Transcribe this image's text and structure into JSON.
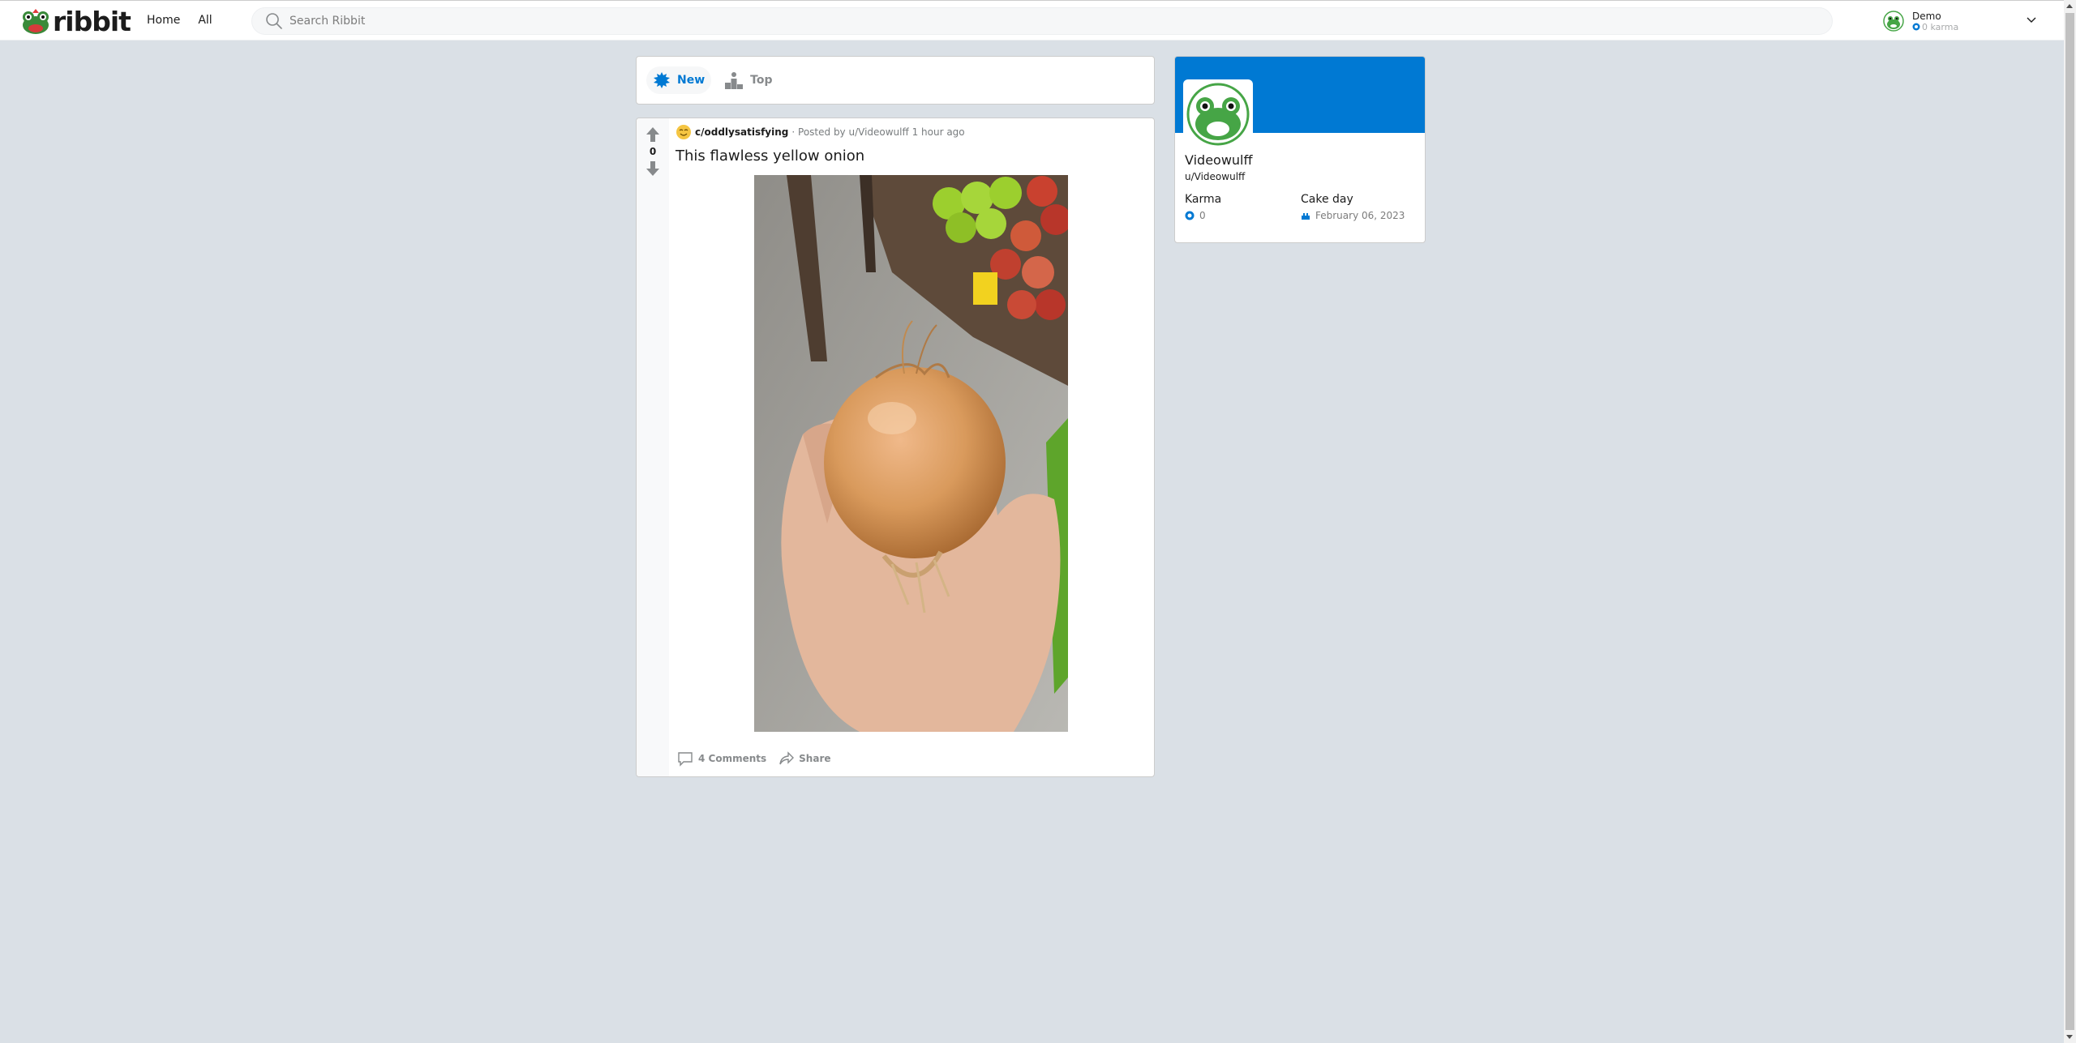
{
  "header": {
    "logo_text": "ribbit",
    "nav": [
      {
        "label": "Home"
      },
      {
        "label": "All"
      }
    ],
    "search": {
      "placeholder": "Search Ribbit",
      "value": ""
    },
    "user": {
      "name": "Demo",
      "karma": "0 karma"
    }
  },
  "sort": {
    "options": [
      {
        "label": "New",
        "active": true,
        "icon": "starburst-icon"
      },
      {
        "label": "Top",
        "active": false,
        "icon": "podium-icon"
      }
    ]
  },
  "post": {
    "votes": "0",
    "community": "c/oddlysatisfying",
    "posted_by": "· Posted by u/Videowulff 1 hour ago",
    "title": "This flawless yellow onion",
    "comments_label": "4 Comments",
    "share_label": "Share"
  },
  "profile": {
    "display_name": "Videowulff",
    "handle": "u/Videowulff",
    "karma_label": "Karma",
    "karma_value": "0",
    "cakeday_label": "Cake day",
    "cakeday_value": "February 06, 2023"
  },
  "colors": {
    "accent": "#0079d3",
    "background": "#dae0e6",
    "frog_green": "#46a546"
  }
}
